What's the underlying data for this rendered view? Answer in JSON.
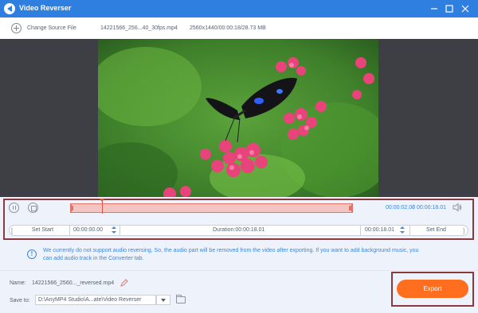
{
  "window": {
    "title": "Video Reverser"
  },
  "toolbar": {
    "change_source_label": "Change Source File",
    "file_name": "14221566_256...40_30fps.mp4",
    "file_info": "2560x1440/00:00:18/28.73 MB"
  },
  "timeline": {
    "current_time": "00:00:02.00",
    "separator": "/",
    "total_time": "00:00:18.01",
    "trim_start_fraction": 0.0,
    "trim_end_fraction": 1.0,
    "playhead_fraction": 0.11
  },
  "trim": {
    "set_start_label": "Set Start",
    "start_time": "00:00:00.00",
    "duration": "Duration:00:00:18.01",
    "end_time": "00:00:18.01",
    "set_end_label": "Set End"
  },
  "notice": {
    "line1": "We currently do not support audio reversing, So, the audio part will be removed from the video after exporting. If you want to add background music, you",
    "line2": "can add audio track in the Converter tab."
  },
  "output": {
    "name_label": "Name:",
    "name_value": "14221566_2560..._reversed.mp4",
    "save_to_label": "Save to:",
    "save_to_path": "D:\\AnyMP4 Studio\\A...ate\\Video Reverser"
  },
  "export": {
    "label": "Export"
  },
  "colors": {
    "accent": "#2f7fe0",
    "export": "#ff6d1f",
    "highlight": "#8a3a3c"
  },
  "icons": [
    "app-icon",
    "minimize-icon",
    "maximize-icon",
    "close-icon",
    "plus-icon",
    "pause-icon",
    "stop-icon",
    "volume-icon",
    "info-icon",
    "edit-icon",
    "folder-icon",
    "chevron-down-icon"
  ]
}
